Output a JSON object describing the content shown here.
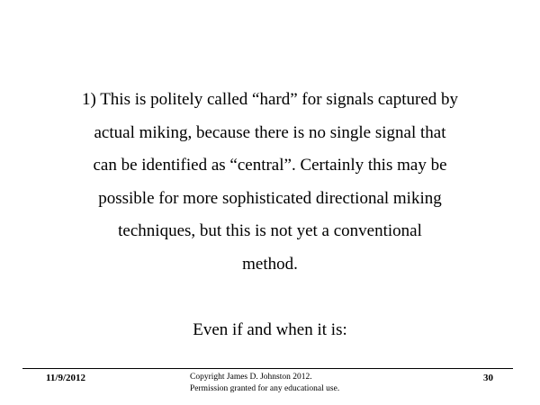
{
  "slide": {
    "body_lines": [
      "1) This is politely called “hard” for signals captured by",
      "actual miking, because there is no single signal that",
      "can be identified as “central”.  Certainly this may be",
      "possible for more sophisticated directional miking",
      "techniques, but this is not yet a conventional",
      "method."
    ],
    "closing_line": "Even if and when it is:"
  },
  "footer": {
    "date": "11/9/2012",
    "copyright_line1": "Copyright James D. Johnston 2012.",
    "copyright_line2": "Permission granted for any educational use.",
    "page_number": "30"
  }
}
